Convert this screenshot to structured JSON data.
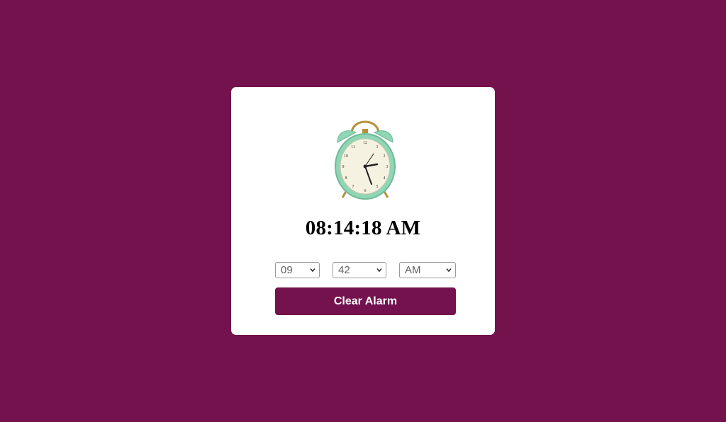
{
  "colors": {
    "background": "#74124e",
    "card": "#ffffff",
    "button": "#74124e",
    "button_text": "#ffffff"
  },
  "clock_image": {
    "icon": "alarm-clock-icon"
  },
  "current_time": "08:14:18 AM",
  "alarm": {
    "hour": {
      "selected": "09"
    },
    "minute": {
      "selected": "42"
    },
    "ampm": {
      "selected": "AM"
    }
  },
  "button": {
    "label": "Clear Alarm"
  }
}
